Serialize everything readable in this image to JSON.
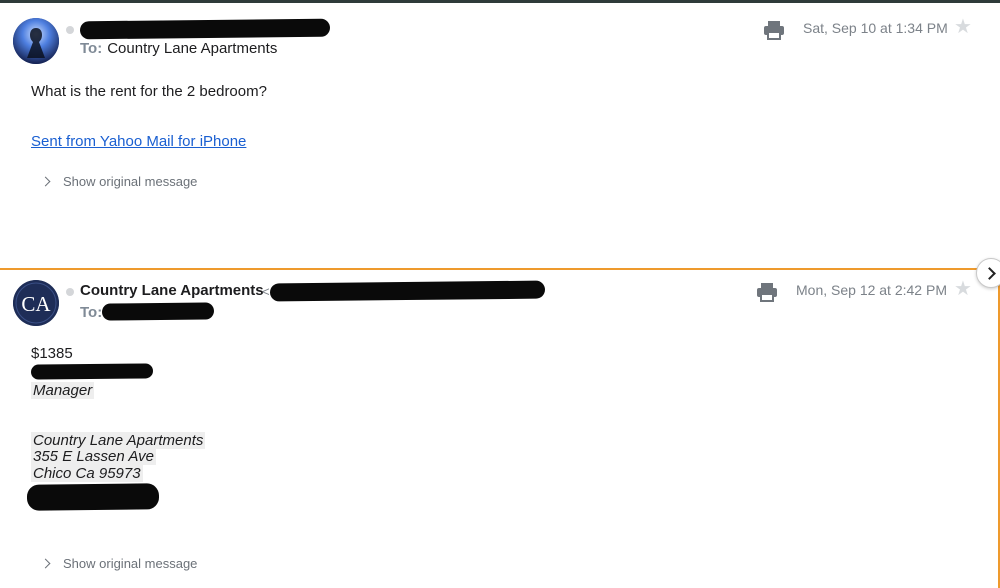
{
  "messages": [
    {
      "to_label": "To:",
      "to_value": "Country Lane Apartments",
      "date": "Sat, Sep 10 at 1:34 PM",
      "body": "What is the rent for the 2 bedroom?",
      "link": "Sent from Yahoo Mail for iPhone",
      "show_original": "Show original message"
    },
    {
      "sender": "Country Lane Apartments",
      "sender_bracket": "<",
      "to_label": "To:",
      "avatar_initials": "CA",
      "date": "Mon, Sep 12 at 2:42 PM",
      "body": "$1385",
      "signature": {
        "title": "Manager",
        "company": "Country Lane Apartments",
        "street": "355 E Lassen Ave",
        "city": "Chico Ca 95973"
      },
      "show_original": "Show original message"
    }
  ],
  "icons": {
    "print": "printer-icon",
    "star": "star-icon",
    "next": "chevron-right-icon"
  },
  "colors": {
    "accent": "#ee9a2d",
    "link": "#1a5fd1",
    "muted": "#7c8289"
  }
}
